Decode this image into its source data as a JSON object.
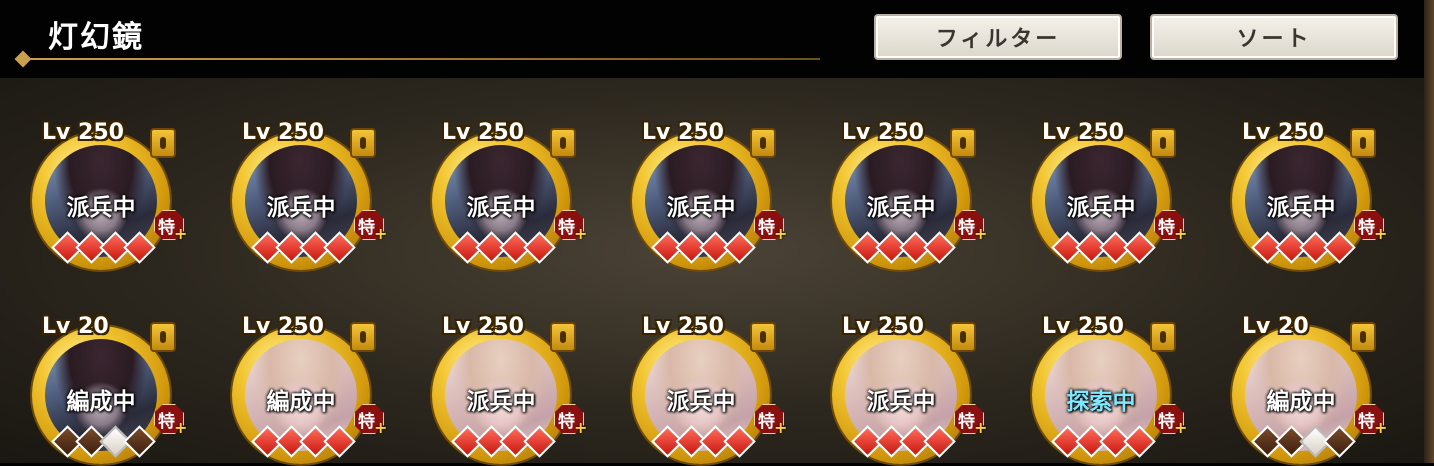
{
  "header": {
    "title": "灯幻鏡",
    "filter_label": "フィルター",
    "sort_label": "ソート"
  },
  "rows": [
    [
      {
        "level": "Lv 250",
        "status": "派兵中",
        "gems": [
          "red",
          "red",
          "red",
          "red"
        ],
        "art": "dark"
      },
      {
        "level": "Lv 250",
        "status": "派兵中",
        "gems": [
          "red",
          "red",
          "red",
          "red"
        ],
        "art": "dark"
      },
      {
        "level": "Lv 250",
        "status": "派兵中",
        "gems": [
          "red",
          "red",
          "red",
          "red"
        ],
        "art": "dark"
      },
      {
        "level": "Lv 250",
        "status": "派兵中",
        "gems": [
          "red",
          "red",
          "red",
          "red"
        ],
        "art": "dark"
      },
      {
        "level": "Lv 250",
        "status": "派兵中",
        "gems": [
          "red",
          "red",
          "red",
          "red"
        ],
        "art": "dark"
      },
      {
        "level": "Lv 250",
        "status": "派兵中",
        "gems": [
          "red",
          "red",
          "red",
          "red"
        ],
        "art": "dark"
      },
      {
        "level": "Lv 250",
        "status": "派兵中",
        "gems": [
          "red",
          "red",
          "red",
          "red"
        ],
        "art": "dark"
      }
    ],
    [
      {
        "level": "Lv 20",
        "status": "編成中",
        "gems": [
          "brown",
          "brown",
          "white",
          "brown"
        ],
        "art": "dark"
      },
      {
        "level": "Lv 250",
        "status": "編成中",
        "gems": [
          "red",
          "red",
          "red",
          "red"
        ],
        "art": "light"
      },
      {
        "level": "Lv 250",
        "status": "派兵中",
        "gems": [
          "red",
          "red",
          "red",
          "red"
        ],
        "art": "light"
      },
      {
        "level": "Lv 250",
        "status": "派兵中",
        "gems": [
          "red",
          "red",
          "red",
          "red"
        ],
        "art": "light"
      },
      {
        "level": "Lv 250",
        "status": "派兵中",
        "gems": [
          "red",
          "red",
          "red",
          "red"
        ],
        "art": "light"
      },
      {
        "level": "Lv 250",
        "status": "探索中",
        "status_color": "#7ee8ff",
        "gems": [
          "red",
          "red",
          "red",
          "red"
        ],
        "art": "light"
      },
      {
        "level": "Lv 20",
        "status": "編成中",
        "gems": [
          "brown",
          "brown",
          "white",
          "brown"
        ],
        "art": "light"
      }
    ]
  ],
  "badge_label": "特",
  "badge_plus": "+",
  "icons": {
    "lock": "lock-icon",
    "badge": "special-trait-badge"
  }
}
